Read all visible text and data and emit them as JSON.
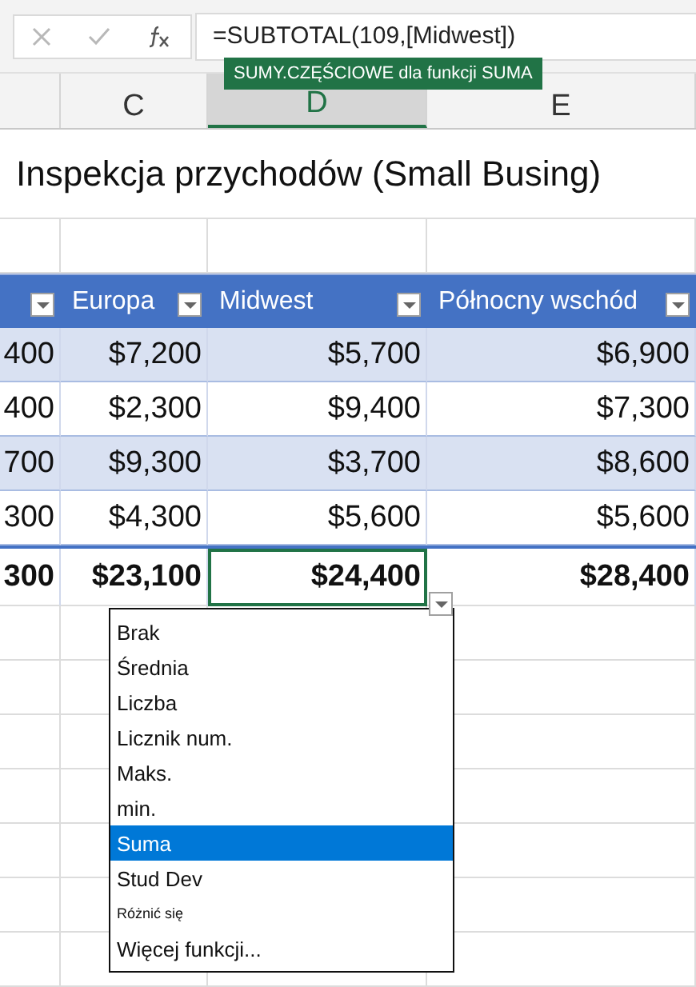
{
  "formula_bar": {
    "formula": "=SUBTOTAL(109,[Midwest])",
    "tooltip": "SUMY.CZĘŚCIOWE dla funkcji SUMA"
  },
  "column_headers": [
    {
      "label": "C",
      "selected": false
    },
    {
      "label": "D",
      "selected": true
    },
    {
      "label": "E",
      "selected": false
    }
  ],
  "title": "Inspekcja przychodów (Small Busing)",
  "table": {
    "columns": [
      "Europa",
      "Midwest",
      "Północny wschód"
    ],
    "rows": [
      {
        "cells": [
          "400",
          "$7,200",
          "$5,700",
          "$6,900"
        ]
      },
      {
        "cells": [
          "400",
          "$2,300",
          "$9,400",
          "$7,300"
        ]
      },
      {
        "cells": [
          "700",
          "$9,300",
          "$3,700",
          "$8,600"
        ]
      },
      {
        "cells": [
          "300",
          "$4,300",
          "$5,600",
          "$5,600"
        ]
      }
    ],
    "total_row": {
      "cells": [
        {
          "text": "300",
          "selected": false
        },
        {
          "text": "$23,100",
          "selected": false
        },
        {
          "text": "$24,400",
          "selected": true
        },
        {
          "text": "$28,400",
          "selected": false
        }
      ]
    }
  },
  "dropdown": {
    "items": [
      {
        "label": "Brak",
        "kind": "normal",
        "selected": false
      },
      {
        "label": "Średnia",
        "kind": "normal",
        "selected": false
      },
      {
        "label": "Liczba",
        "kind": "normal",
        "selected": false
      },
      {
        "label": "Licznik num.",
        "kind": "normal",
        "selected": false
      },
      {
        "label": "Maks.",
        "kind": "normal",
        "selected": false
      },
      {
        "label": "min.",
        "kind": "normal",
        "selected": false
      },
      {
        "label": "Suma",
        "kind": "normal",
        "selected": true
      },
      {
        "label": "Stud Dev",
        "kind": "normal",
        "selected": false
      },
      {
        "label": "Różnić się",
        "kind": "small",
        "selected": false
      },
      {
        "label": "Więcej funkcji...",
        "kind": "normal",
        "selected": false
      }
    ]
  }
}
